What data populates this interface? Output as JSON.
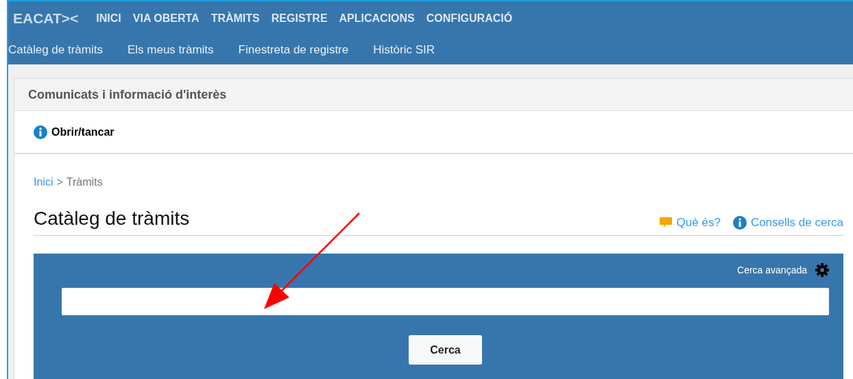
{
  "logo": "EACAT><",
  "main_nav": [
    {
      "label": "INICI"
    },
    {
      "label": "VIA OBERTA"
    },
    {
      "label": "TRÀMITS"
    },
    {
      "label": "REGISTRE"
    },
    {
      "label": "APLICACIONS"
    },
    {
      "label": "CONFIGURACIÓ"
    }
  ],
  "sub_nav": [
    {
      "label": "Catàleg de tràmits"
    },
    {
      "label": "Els meus tràmits"
    },
    {
      "label": "Finestreta de registre"
    },
    {
      "label": "Històric SIR"
    }
  ],
  "notice_panel": {
    "title": "Comunicats i informació d'interès",
    "toggle": "Obrir/tancar"
  },
  "breadcrumb": {
    "link": "Inici",
    "separator": ">",
    "current": "Tràmits"
  },
  "page_title": "Catàleg de tràmits",
  "help_links": [
    {
      "label": "Què és?",
      "kind": "chat"
    },
    {
      "label": "Consells de cerca",
      "kind": "info"
    }
  ],
  "search": {
    "advanced": "Cerca avançada",
    "button": "Cerca"
  }
}
